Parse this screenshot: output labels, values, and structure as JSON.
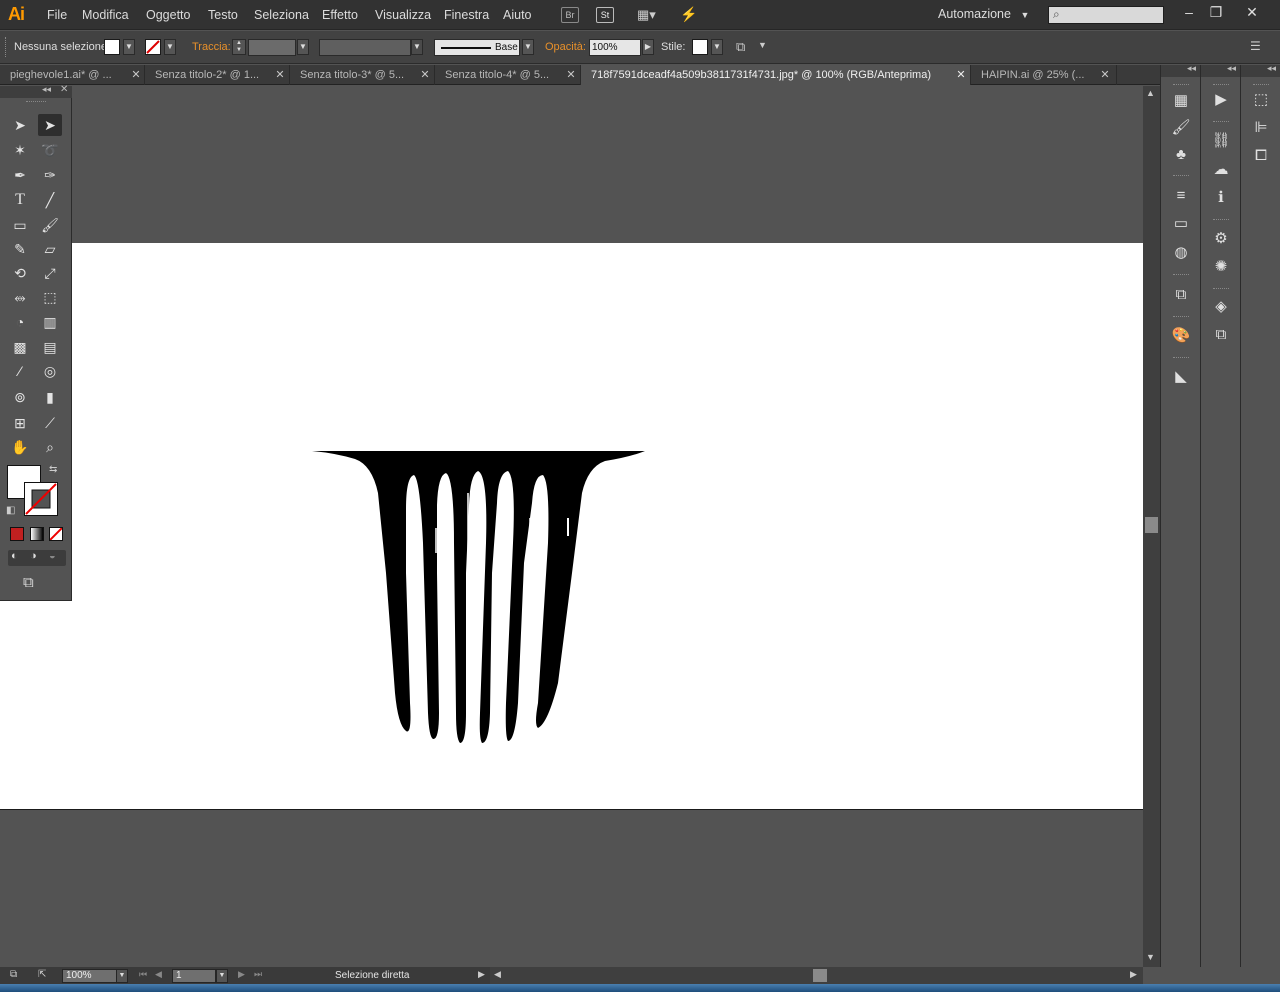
{
  "app": {
    "logo": "Ai"
  },
  "menu": [
    "File",
    "Modifica",
    "Oggetto",
    "Testo",
    "Seleziona",
    "Effetto",
    "Visualizza",
    "Finestra",
    "Aiuto"
  ],
  "menubar_right": {
    "bridge": "Br",
    "stock": "St",
    "workspace": "Automazione"
  },
  "control": {
    "selection": "Nessuna selezione",
    "stroke_label": "Traccia:",
    "brush": "Base",
    "opacity_label": "Opacità:",
    "opacity_value": "100%",
    "style_label": "Stile:"
  },
  "tabs": [
    {
      "label": "pieghevole1.ai* @ ...",
      "active": false
    },
    {
      "label": "Senza titolo-2* @ 1...",
      "active": false
    },
    {
      "label": "Senza titolo-3* @ 5...",
      "active": false
    },
    {
      "label": "Senza titolo-4* @ 5...",
      "active": false
    },
    {
      "label": "718f7591dceadf4a509b3811731f4731.jpg* @ 100% (RGB/Anteprima)",
      "active": true
    },
    {
      "label": "HAIPIN.ai @ 25% (...",
      "active": false
    }
  ],
  "status": {
    "zoom": "100%",
    "artboard": "1",
    "tool": "Selezione diretta"
  },
  "colors": {
    "accent": "#ff9a00",
    "ui_bg": "#535353",
    "menubar": "#323232",
    "artboard": "#ffffff"
  }
}
